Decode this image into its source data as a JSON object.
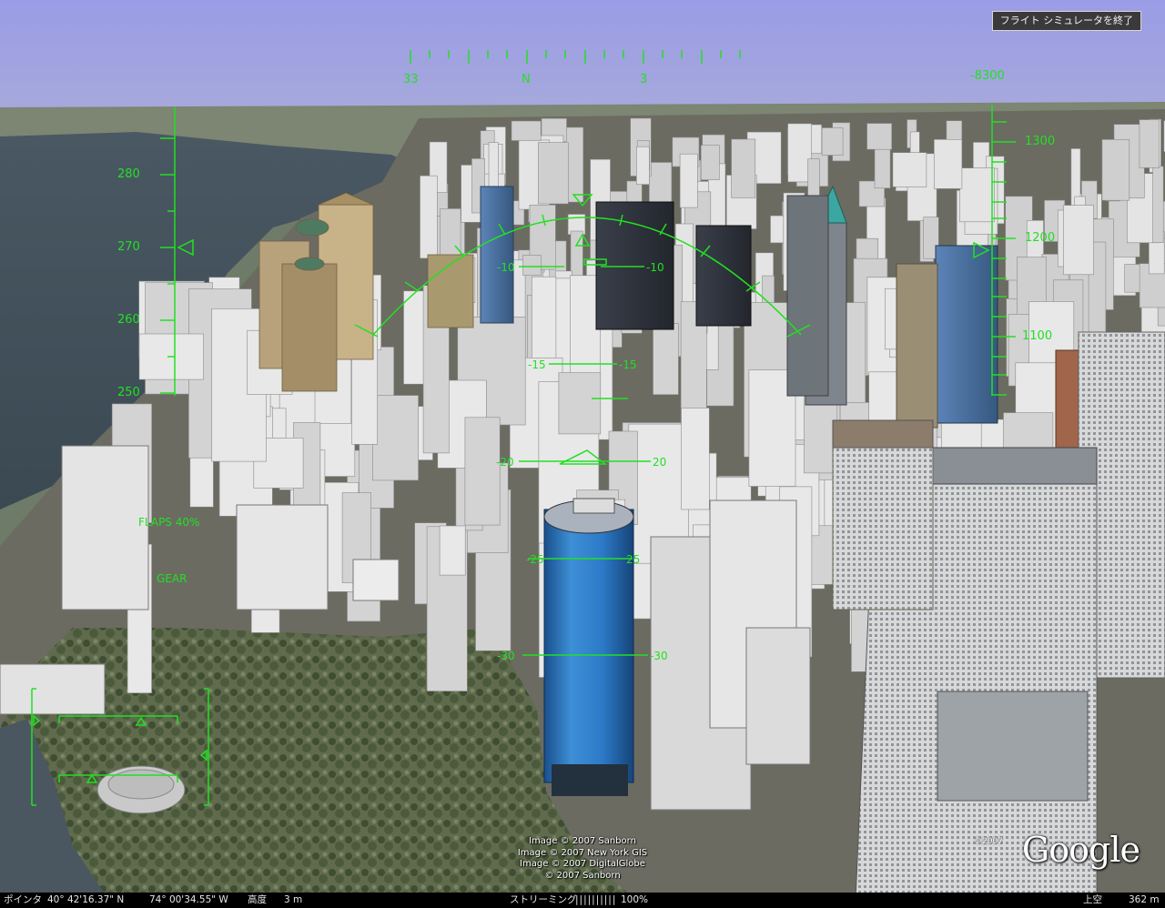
{
  "exit_button": "フライト シミュレータを終了",
  "heading_tape": {
    "labels": [
      "33",
      "N",
      "3"
    ]
  },
  "speed_tape": {
    "labels": [
      "280",
      "270",
      "260",
      "250"
    ]
  },
  "altitude_tape": {
    "top_readout": "-8300",
    "labels": [
      "1300",
      "1200",
      "1100"
    ]
  },
  "pitch_ladder": {
    "rung_10": [
      "-10",
      "-10"
    ],
    "rung_15": [
      "-15",
      "-15"
    ],
    "rung_20": [
      "-20",
      "20"
    ],
    "rung_25": [
      "-25",
      "25"
    ],
    "rung_30": [
      "-30",
      "-30"
    ]
  },
  "flaps": "FLAPS 40%",
  "gear": "GEAR",
  "credits": [
    "Image © 2007 Sanborn",
    "Image © 2007 New York GIS",
    "Image © 2007 DigitalGlobe",
    "© 2007 Sanborn"
  ],
  "google_logo": "Google",
  "google_copyright": "©2007",
  "status_bar": {
    "pointer_label": "ポインタ",
    "latitude": "40° 42'16.37\" N",
    "longitude": "74° 00'34.55\" W",
    "elevation_label": "高度",
    "elevation_value": "3 m",
    "streaming_label": "ストリーミング",
    "streaming_bars": "||||||||||",
    "streaming_percent": "100%",
    "eye_alt_label": "上空",
    "eye_alt_value": "362 m"
  },
  "colors": {
    "hud": "#22e022",
    "sky": "#9c9ee6",
    "water": "#3f4e5a"
  }
}
